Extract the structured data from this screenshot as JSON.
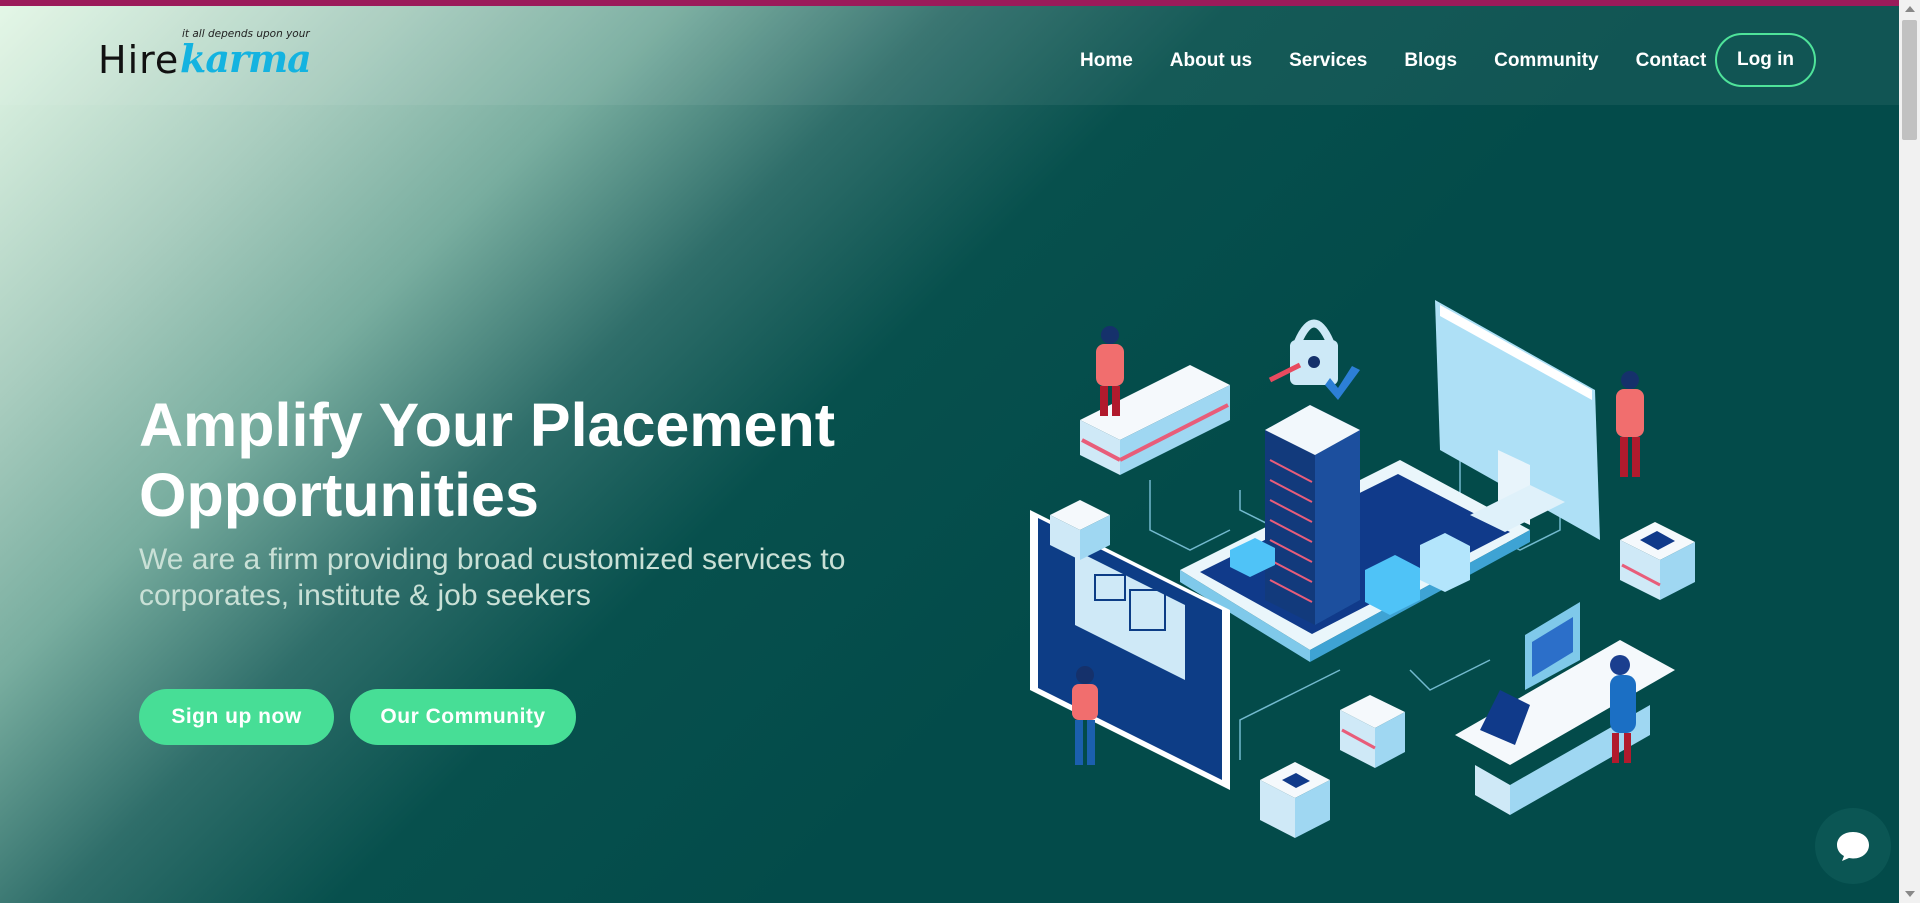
{
  "logo": {
    "tagline": "it all depends upon your",
    "hire": "Hire",
    "karma": "karma"
  },
  "nav": {
    "items": [
      {
        "label": "Home"
      },
      {
        "label": "About us"
      },
      {
        "label": "Services"
      },
      {
        "label": "Blogs"
      },
      {
        "label": "Community"
      },
      {
        "label": "Contact"
      }
    ],
    "login_label": "Log in"
  },
  "hero": {
    "title_line1": "Amplify Your Placement",
    "title_line2": "Opportunities",
    "subtitle_line1": "We are a firm providing broad customized services to",
    "subtitle_line2": "corporates, institute & job seekers",
    "signup_label": "Sign up now",
    "community_label": "Our Community"
  },
  "colors": {
    "accent_green": "#47de96",
    "dark_teal": "#034b4a",
    "top_bar": "#9b1b5a",
    "logo_blue": "#14b3e0"
  },
  "icons": {
    "chat": "chat-bubble-icon",
    "illustration": "isometric-city-illustration"
  }
}
